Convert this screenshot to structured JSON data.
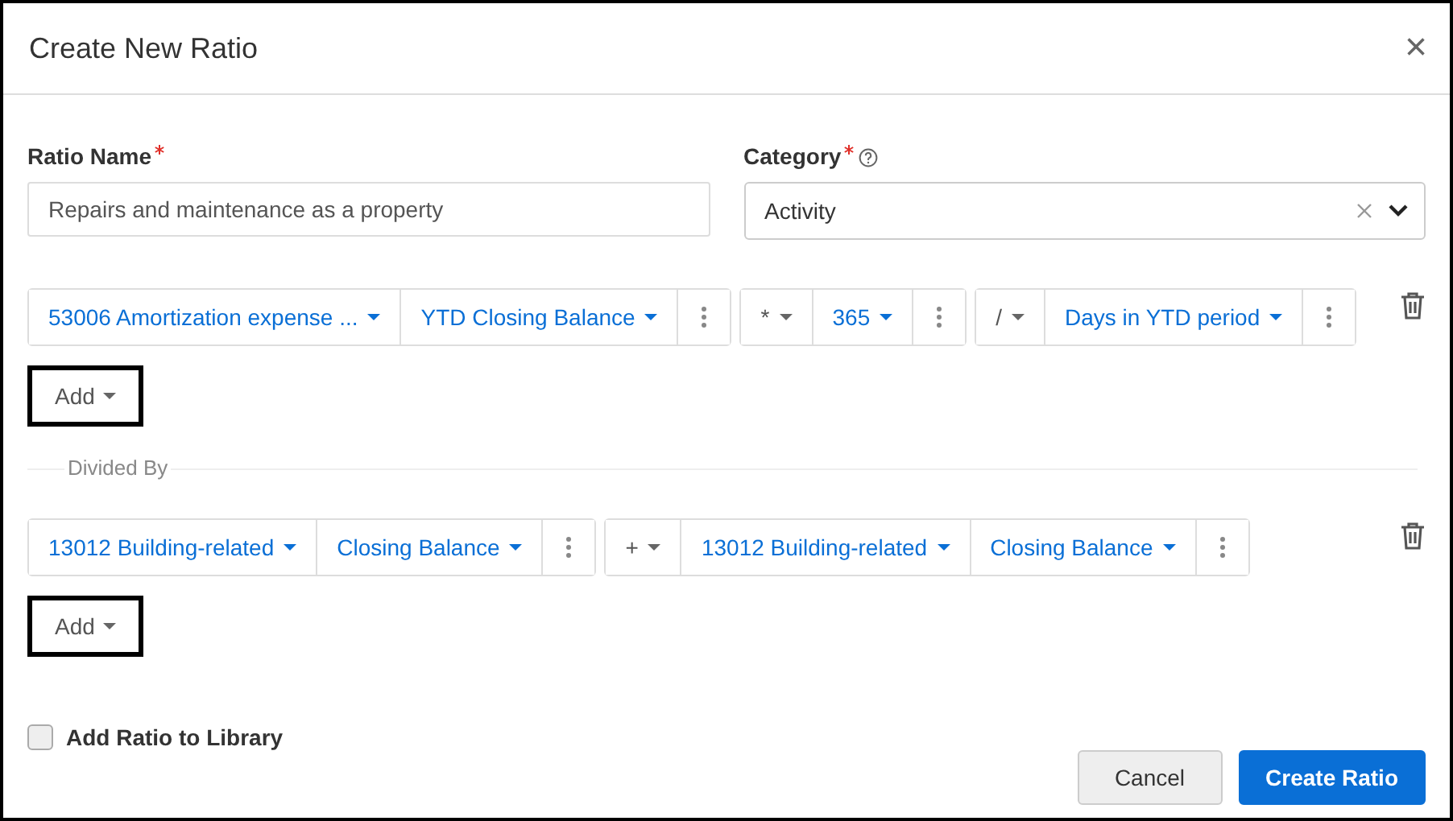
{
  "dialog": {
    "title": "Create New Ratio",
    "close": "×"
  },
  "ratio_name": {
    "label": "Ratio Name",
    "required": true,
    "value": "Repairs and maintenance as a property"
  },
  "category": {
    "label": "Category",
    "required": true,
    "value": "Activity"
  },
  "numerator": {
    "groups": [
      {
        "segments": [
          {
            "kind": "field",
            "text": "53006 Amortization expense ..."
          },
          {
            "kind": "field",
            "text": "YTD Closing Balance"
          },
          {
            "kind": "more"
          }
        ]
      },
      {
        "segments": [
          {
            "kind": "operator",
            "text": "*"
          },
          {
            "kind": "field",
            "text": "365"
          },
          {
            "kind": "more"
          }
        ]
      },
      {
        "segments": [
          {
            "kind": "operator",
            "text": "/"
          },
          {
            "kind": "field",
            "text": "Days in YTD period"
          },
          {
            "kind": "more"
          }
        ]
      }
    ],
    "add": {
      "label": "Add",
      "highlighted": true
    }
  },
  "divider": {
    "label": "Divided By"
  },
  "denominator": {
    "groups": [
      {
        "segments": [
          {
            "kind": "field",
            "text": "13012 Building-related"
          },
          {
            "kind": "field",
            "text": "Closing Balance"
          },
          {
            "kind": "more"
          }
        ]
      },
      {
        "segments": [
          {
            "kind": "operator",
            "text": "+"
          },
          {
            "kind": "field",
            "text": "13012 Building-related"
          },
          {
            "kind": "field",
            "text": "Closing Balance"
          },
          {
            "kind": "more"
          }
        ]
      }
    ],
    "add": {
      "label": "Add",
      "highlighted": true
    }
  },
  "library": {
    "label": "Add Ratio to Library",
    "checked": false
  },
  "buttons": [
    {
      "kind": "secondary",
      "label": "Cancel"
    },
    {
      "kind": "primary",
      "label": "Create Ratio"
    }
  ]
}
